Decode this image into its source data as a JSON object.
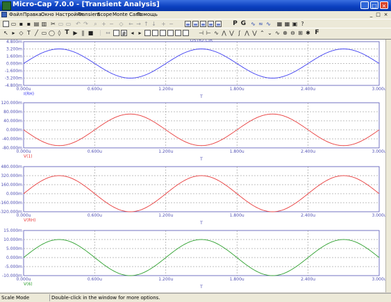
{
  "window": {
    "title": "Micro-Cap 7.0.0 - [Transient Analysis]",
    "controls": {
      "minimize": "_",
      "maximize": "□",
      "close": "×"
    }
  },
  "menu": {
    "items": [
      "Файл",
      "Правка",
      "Окно",
      "Настройки",
      "Transient",
      "Scope",
      "Monte Carlo",
      "Помощь"
    ],
    "mdi_controls": [
      "_",
      "□",
      "×"
    ]
  },
  "toolbar1": {
    "icons": [
      "new-icon",
      "open-icon",
      "save-icon",
      "save-all-icon",
      "print-icon",
      "print-preview-icon",
      "cut-icon",
      "copy-icon",
      "paste-icon",
      "undo-icon",
      "redo-icon",
      "find-icon",
      "zoom-in-icon",
      "zoom-out-icon",
      "zoom-fit-icon",
      "arrow-left-icon",
      "arrow-right-icon",
      "arrow-up-icon",
      "arrow-down-icon",
      "add-icon",
      "minus-icon",
      "layout-icon-1",
      "layout-icon-2",
      "layout-icon-3",
      "layout-icon-4",
      "layout-icon-5"
    ],
    "letters": {
      "p": "P",
      "g": "G"
    }
  },
  "toolbar2": {
    "letter_f": "F"
  },
  "plot": {
    "file_label": "OSTR2.CIR",
    "x_axis_label": "T",
    "x_ticks": [
      "0.000u",
      "0.600u",
      "1.200u",
      "1.800u",
      "2.400u",
      "3.000u"
    ],
    "colors": {
      "blue": "#3c3cf0",
      "red": "#e83c3c",
      "green": "#2ea02e",
      "axis": "#5050b4"
    }
  },
  "chart_data": [
    {
      "type": "line",
      "title": "",
      "series": [
        {
          "name": "I(RH)",
          "color": "#3c3cf0"
        }
      ],
      "amplitude": 3.2,
      "phase_sign": 1,
      "x": {
        "min": 0,
        "max": 3.0,
        "unit": "u",
        "period": 1.2
      },
      "ylim": [
        -4.8,
        4.8
      ],
      "y_ticks": [
        "4.800m",
        "3.200m",
        "1.600m",
        "0.000m",
        "-1.600m",
        "-3.200m",
        "-4.800m"
      ],
      "xlabel": "T",
      "grid": true
    },
    {
      "type": "line",
      "title": "",
      "series": [
        {
          "name": "V(1)",
          "color": "#e83c3c"
        }
      ],
      "amplitude": 70,
      "phase_sign": -1,
      "x": {
        "min": 0,
        "max": 3.0,
        "unit": "u",
        "period": 1.2
      },
      "ylim": [
        -80,
        120
      ],
      "y_ticks": [
        "120.000m",
        "80.000m",
        "40.000m",
        "0.000m",
        "-40.000m",
        "-80.000m"
      ],
      "xlabel": "T",
      "grid": true
    },
    {
      "type": "line",
      "title": "",
      "series": [
        {
          "name": "V(RH)",
          "color": "#e83c3c"
        }
      ],
      "amplitude": 320,
      "phase_sign": 1,
      "x": {
        "min": 0,
        "max": 3.0,
        "unit": "u",
        "period": 1.2
      },
      "ylim": [
        -320,
        480
      ],
      "y_ticks": [
        "480.000m",
        "320.000m",
        "160.000m",
        "0.000m",
        "-160.000m",
        "-320.000m"
      ],
      "xlabel": "T",
      "grid": true
    },
    {
      "type": "line",
      "title": "",
      "series": [
        {
          "name": "V(6)",
          "color": "#2ea02e"
        }
      ],
      "amplitude": 10,
      "phase_sign": 1,
      "x": {
        "min": 0,
        "max": 3.0,
        "unit": "u",
        "period": 1.2
      },
      "ylim": [
        -10,
        15
      ],
      "y_ticks": [
        "15.000m",
        "10.000m",
        "5.000m",
        "0.000m",
        "-5.000m",
        "-10.000m"
      ],
      "xlabel": "T",
      "grid": true
    }
  ],
  "status": {
    "mode": "Scale Mode",
    "hint": "Double-click in the window for more options."
  }
}
